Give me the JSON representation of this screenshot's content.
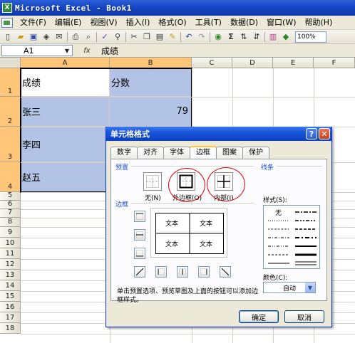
{
  "window": {
    "title": "Microsoft Excel - Book1",
    "app_icon": "excel-icon"
  },
  "menu": [
    "文件(F)",
    "编辑(E)",
    "视图(V)",
    "插入(I)",
    "格式(O)",
    "工具(T)",
    "数据(D)",
    "窗口(W)",
    "帮助(H)"
  ],
  "toolbar": {
    "zoom": "100%"
  },
  "formula_bar": {
    "name_box": "A1",
    "fx_label": "fx",
    "value": "成绩"
  },
  "columns": [
    "A",
    "B",
    "C",
    "D",
    "E",
    "F"
  ],
  "rows": [
    "1",
    "2",
    "3",
    "4",
    "5",
    "6",
    "7",
    "8",
    "9",
    "10",
    "11",
    "12",
    "13",
    "14",
    "15",
    "16",
    "17",
    "18"
  ],
  "cells": {
    "a1": "成绩",
    "b1": "分数",
    "a2": "张三",
    "b2": "79",
    "a3": "李四",
    "a4": "赵五"
  },
  "dialog": {
    "title": "单元格格式",
    "help_glyph": "?",
    "close_glyph": "✕",
    "tabs": [
      "数字",
      "对齐",
      "字体",
      "边框",
      "图案",
      "保护"
    ],
    "active_tab": "边框",
    "presets_label": "预置",
    "preset_none": "无(N)",
    "preset_outline": "外边框(O)",
    "preset_inside": "内部(I)",
    "border_label": "边框",
    "preview_text": [
      "文本",
      "文本",
      "文本",
      "文本"
    ],
    "line_label": "线条",
    "style_label": "样式(S):",
    "style_none": "无",
    "color_label": "颜色(C):",
    "color_value": "自动",
    "hint": "单击预置选项、预览草图及上面的按钮可以添加边框样式。",
    "ok": "确定",
    "cancel": "取消"
  }
}
